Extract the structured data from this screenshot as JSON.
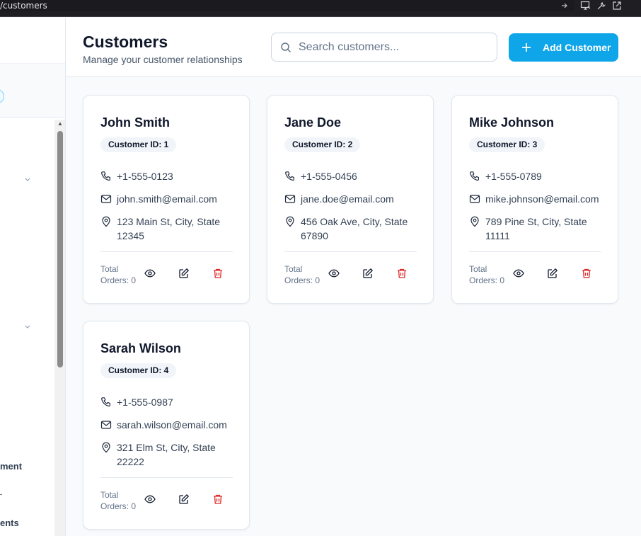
{
  "browser": {
    "url": "/customers"
  },
  "sidebar": {
    "labels": [
      "ment",
      "ents"
    ]
  },
  "header": {
    "title": "Customers",
    "subtitle": "Manage your customer relationships",
    "search_placeholder": "Search customers...",
    "add_button_label": "Add Customer"
  },
  "customers": [
    {
      "name": "John Smith",
      "badge": "Customer ID: 1",
      "phone": "+1-555-0123",
      "email": "john.smith@email.com",
      "address_line1": "123 Main St, City, State",
      "address_line2": "12345",
      "orders_line1": "Total",
      "orders_line2": "Orders: 0"
    },
    {
      "name": "Jane Doe",
      "badge": "Customer ID: 2",
      "phone": "+1-555-0456",
      "email": "jane.doe@email.com",
      "address_line1": "456 Oak Ave, City, State",
      "address_line2": "67890",
      "orders_line1": "Total",
      "orders_line2": "Orders: 0"
    },
    {
      "name": "Mike Johnson",
      "badge": "Customer ID: 3",
      "phone": "+1-555-0789",
      "email": "mike.johnson@email.com",
      "address_line1": "789 Pine St, City, State",
      "address_line2": "11111",
      "orders_line1": "Total",
      "orders_line2": "Orders: 0"
    },
    {
      "name": "Sarah Wilson",
      "badge": "Customer ID: 4",
      "phone": "+1-555-0987",
      "email": "sarah.wilson@email.com",
      "address_line1": "321 Elm St, City, State",
      "address_line2": "22222",
      "orders_line1": "Total",
      "orders_line2": "Orders: 0"
    }
  ],
  "icons": {
    "phone": "phone-icon",
    "email": "mail-icon",
    "address": "map-pin-icon",
    "view": "eye-icon",
    "edit": "edit-icon",
    "delete": "trash-icon"
  },
  "colors": {
    "accent": "#0ea5e9",
    "danger": "#dc2626",
    "text": "#0f172a",
    "muted": "#64748b"
  }
}
